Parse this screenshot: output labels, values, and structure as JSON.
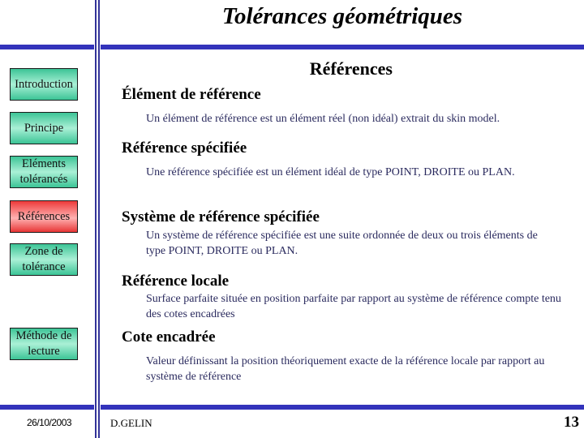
{
  "header": {
    "title": "Tolérances géométriques"
  },
  "section": {
    "title": "Références"
  },
  "nav": {
    "items": [
      {
        "label": "Introduction",
        "active": false
      },
      {
        "label": "Principe",
        "active": false
      },
      {
        "label": "Eléments tolérancés",
        "active": false
      },
      {
        "label": "Références",
        "active": true
      },
      {
        "label": "Zone de tolérance",
        "active": false
      },
      {
        "label": "Méthode de lecture",
        "active": false
      }
    ]
  },
  "content": {
    "entries": [
      {
        "term": "Élément de référence",
        "definition": "Un élément de référence est un élément réel (non idéal) extrait du skin model."
      },
      {
        "term": "Référence spécifiée",
        "definition": "Une référence spécifiée est un élément idéal de type POINT, DROITE ou PLAN."
      },
      {
        "term": "Système de référence spécifiée",
        "definition": "Un système de référence spécifiée est une suite ordonnée de deux ou trois éléments de type POINT, DROITE ou PLAN."
      },
      {
        "term": "Référence locale",
        "definition": "Surface parfaite située en position parfaite par rapport au système de référence compte tenu des cotes encadrées"
      },
      {
        "term": "Cote encadrée",
        "definition": "Valeur définissant la position théoriquement exacte de la référence locale par rapport au système de référence"
      }
    ]
  },
  "footer": {
    "date": "26/10/2003",
    "author": "D.GELIN",
    "page_number": "13"
  },
  "colors": {
    "rule": "#3333bb",
    "nav_button": "#3cc496",
    "nav_button_active": "#ee3a3a",
    "definition_text": "#2a2a5e"
  }
}
